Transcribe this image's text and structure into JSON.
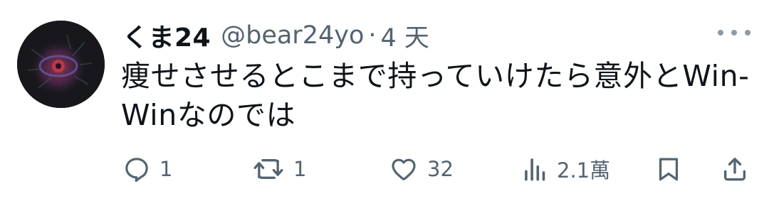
{
  "tweet": {
    "display_name": "くま24",
    "handle": "@bear24yo",
    "separator": "·",
    "time": "4 天",
    "text": "痩せさせるとこまで持っていけたら意外とWin-Winなのでは"
  },
  "actions": {
    "reply_count": "1",
    "retweet_count": "1",
    "like_count": "32",
    "views_count": "2.1萬"
  },
  "icons": {
    "more": "more-horizontal-icon",
    "reply": "reply-icon",
    "retweet": "retweet-icon",
    "like": "heart-icon",
    "views": "views-chart-icon",
    "bookmark": "bookmark-icon",
    "share": "share-icon"
  },
  "colors": {
    "text_primary": "#0f1419",
    "text_secondary": "#536471",
    "background": "#ffffff"
  }
}
